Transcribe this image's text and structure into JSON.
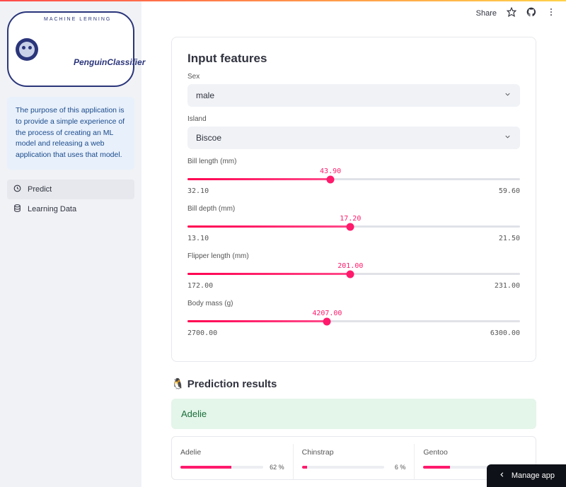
{
  "toolbar": {
    "share": "Share"
  },
  "sidebar": {
    "logo_sub": "MACHINE LERNING",
    "logo_main": "PenguinClassifier",
    "description": "The purpose of this application is to provide a simple experience of the process of creating an ML model and releasing a web application that uses that model.",
    "nav": [
      {
        "label": "Predict",
        "active": true
      },
      {
        "label": "Learning Data",
        "active": false
      }
    ]
  },
  "input_card": {
    "title": "Input features",
    "sex": {
      "label": "Sex",
      "value": "male"
    },
    "island": {
      "label": "Island",
      "value": "Biscoe"
    },
    "sliders": [
      {
        "label": "Bill length (mm)",
        "min": "32.10",
        "max": "59.60",
        "value": "43.90",
        "pct": 43
      },
      {
        "label": "Bill depth (mm)",
        "min": "13.10",
        "max": "21.50",
        "value": "17.20",
        "pct": 49
      },
      {
        "label": "Flipper length (mm)",
        "min": "172.00",
        "max": "231.00",
        "value": "201.00",
        "pct": 49
      },
      {
        "label": "Body mass (g)",
        "min": "2700.00",
        "max": "6300.00",
        "value": "4207.00",
        "pct": 42
      }
    ]
  },
  "results": {
    "title": "Prediction results",
    "predicted": "Adelie",
    "probs": [
      {
        "label": "Adelie",
        "value": "62 %",
        "pct": 62
      },
      {
        "label": "Chinstrap",
        "value": "6 %",
        "pct": 6
      },
      {
        "label": "Gentoo",
        "value": "32 %",
        "pct": 32
      }
    ]
  },
  "footer": {
    "manage": "Manage app"
  }
}
